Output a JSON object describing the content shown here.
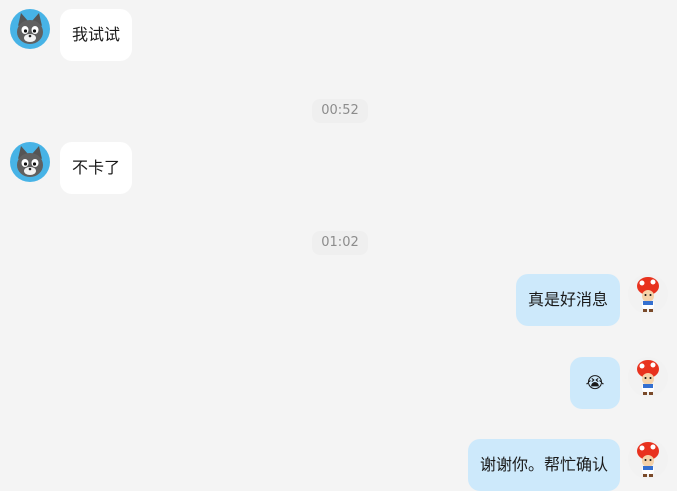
{
  "messages": [
    {
      "text": "我试试"
    },
    {
      "timestamp": "00:52"
    },
    {
      "text": "不卡了"
    },
    {
      "timestamp": "01:02"
    },
    {
      "text": "真是好消息"
    },
    {
      "emoji": "😭"
    },
    {
      "text": "谢谢你。帮忙确认"
    }
  ],
  "colors": {
    "background": "#f4f4f4",
    "incoming_bubble": "#ffffff",
    "outgoing_bubble": "#cde9fb",
    "timestamp_text": "#8c8c8c"
  }
}
